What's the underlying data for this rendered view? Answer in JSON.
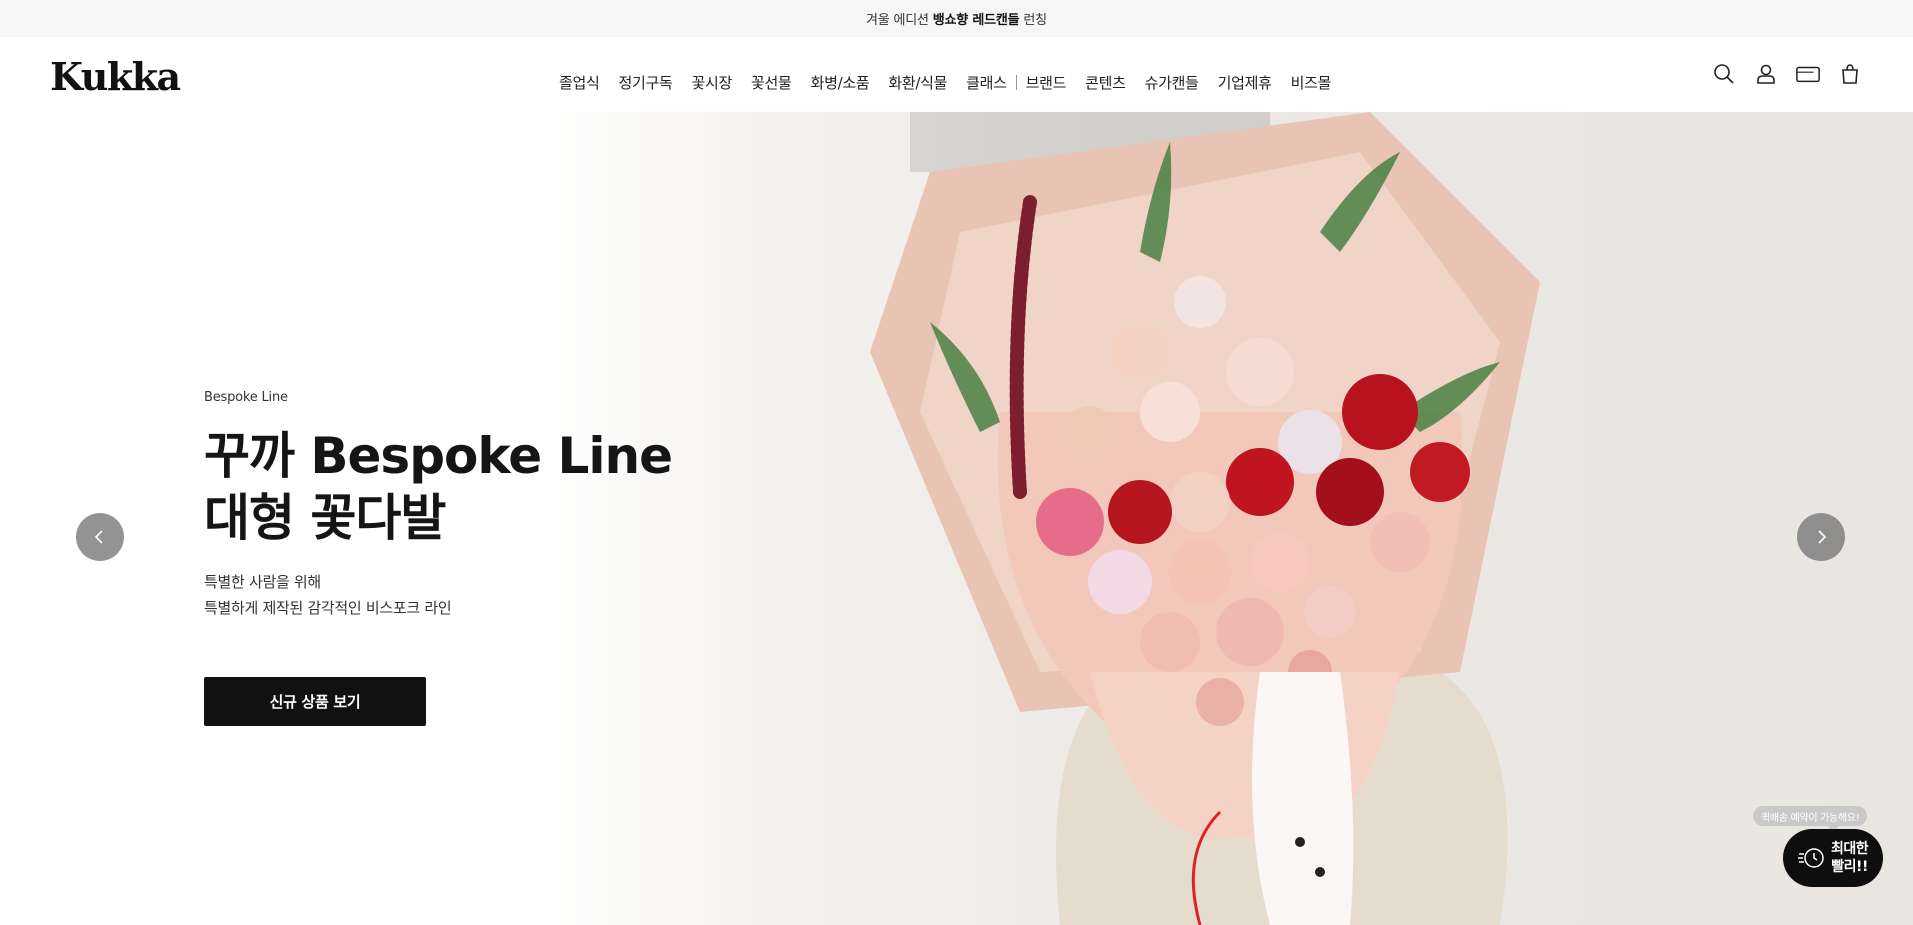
{
  "announcement": {
    "prefix": "겨울 에디션",
    "bold": "뱅쇼향 레드캔들",
    "suffix": "런칭"
  },
  "brand": {
    "logo_text": "Kukka"
  },
  "nav": {
    "items": [
      "졸업식",
      "정기구독",
      "꽃시장",
      "꽃선물",
      "화병/소품",
      "화환/식물",
      "클래스",
      "브랜드",
      "콘텐츠",
      "슈가캔들",
      "기업제휴",
      "비즈몰"
    ]
  },
  "header_icons": [
    "search-icon",
    "user-icon",
    "card-icon",
    "cart-icon"
  ],
  "hero": {
    "eyebrow": "Bespoke Line",
    "headline_line1": "꾸까 Bespoke Line",
    "headline_line2": "대형 꽃다발",
    "desc_line1": "특별한 사람을 위해",
    "desc_line2": "특별하게 제작된 감각적인 비스포크 라인",
    "cta_label": "신규 상품 보기"
  },
  "quick_delivery": {
    "tooltip": "퀵배송 예약이 가능해요!",
    "line1": "최대한",
    "line2": "빨리!!"
  },
  "colors": {
    "accent": "#111111",
    "rose_red": "#b8121e",
    "paper_pink": "#f0d4c8"
  }
}
